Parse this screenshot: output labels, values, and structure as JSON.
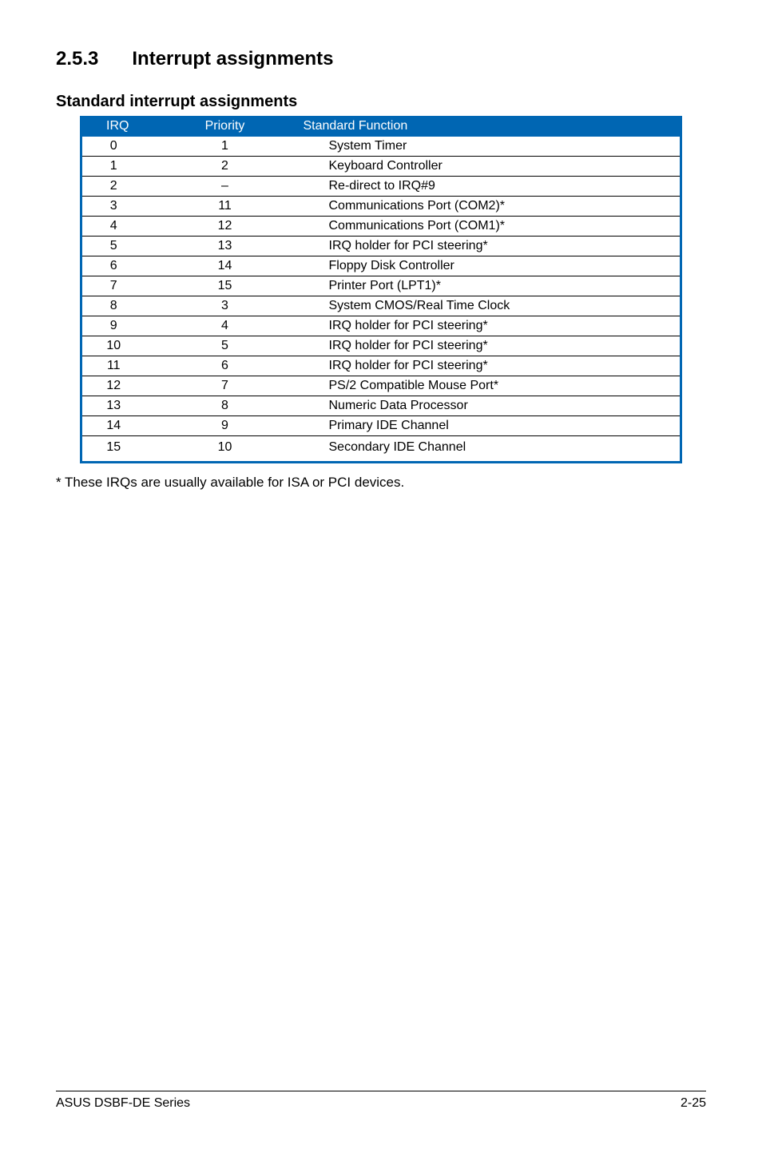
{
  "heading": {
    "number": "2.5.3",
    "title": "Interrupt assignments"
  },
  "subheading": "Standard interrupt assignments",
  "table": {
    "headers": {
      "irq": "IRQ",
      "priority": "Priority",
      "function": "Standard Function"
    },
    "rows": [
      {
        "irq": "0",
        "priority": "1",
        "function": "System Timer"
      },
      {
        "irq": "1",
        "priority": "2",
        "function": "Keyboard Controller"
      },
      {
        "irq": "2",
        "priority": "–",
        "function": "Re-direct to IRQ#9"
      },
      {
        "irq": "3",
        "priority": "11",
        "function": "Communications Port (COM2)*"
      },
      {
        "irq": "4",
        "priority": "12",
        "function": "Communications Port (COM1)*"
      },
      {
        "irq": "5",
        "priority": "13",
        "function": "IRQ holder for PCI steering*"
      },
      {
        "irq": "6",
        "priority": "14",
        "function": "Floppy Disk Controller"
      },
      {
        "irq": "7",
        "priority": "15",
        "function": "Printer Port (LPT1)*"
      },
      {
        "irq": "8",
        "priority": "3",
        "function": "System CMOS/Real Time Clock"
      },
      {
        "irq": "9",
        "priority": "4",
        "function": "IRQ holder for PCI steering*"
      },
      {
        "irq": "10",
        "priority": "5",
        "function": "IRQ holder for PCI steering*"
      },
      {
        "irq": "11",
        "priority": "6",
        "function": "IRQ holder for PCI steering*"
      },
      {
        "irq": "12",
        "priority": "7",
        "function": "PS/2 Compatible Mouse Port*"
      },
      {
        "irq": "13",
        "priority": "8",
        "function": "Numeric Data Processor"
      },
      {
        "irq": "14",
        "priority": "9",
        "function": "Primary IDE Channel"
      },
      {
        "irq": "15",
        "priority": "10",
        "function": "Secondary IDE Channel"
      }
    ]
  },
  "footnote": "* These IRQs are usually available for ISA or PCI devices.",
  "footer": {
    "left": "ASUS DSBF-DE Series",
    "right": "2-25"
  }
}
